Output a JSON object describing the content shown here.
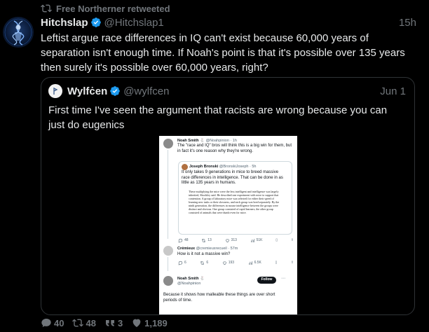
{
  "retweet": {
    "label": "Free Northerner retweeted",
    "icon": "retweet-icon"
  },
  "tweet": {
    "author": {
      "name": "Hitchslap",
      "handle": "@Hitchslap1",
      "verified": true
    },
    "time": "15h",
    "text": "Leftist argue race differences in IQ can't exist because 60,000 years of separation isn't enough time. If Noah's point is that it's possible over 135 years then surely it's possible over 60,000 years, right?"
  },
  "quote": {
    "author": {
      "name": "Wylfċen",
      "handle": "@wylfcen",
      "verified": true
    },
    "time": "Jun 1",
    "text": "First time I've seen the argument that racists are wrong because you can just do eugenics",
    "screenshot": {
      "post1": {
        "name": "Noah Smith",
        "emoji": "🐇",
        "handle": "@Noahpinion",
        "time": "· 1h",
        "text": "The \"race and IQ\" bros will think this is a big win for them, but in fact it's one reason why they're wrong.",
        "quoted": {
          "name": "Joseph Bronski",
          "handle": "@BronskiJoseph",
          "time": "· 5h",
          "text": "It only takes 9 generations in mice to breed massive race differences in intelligence. That can be done in as little as 135 years in humans.",
          "page_text": "These multiplying the mice were the less intelligent and intelligence was largely inherited, Shockley said. He described one experiment with mice to support that contention. A group of laboratory mice was selected for either their speed of learning new tasks or their slowness, and each group was bred separately. By the ninth generation, the differences in mouse intelligence between the groups were distinct and obvious. One group consisted of rapid learners, the other group consisted of animals that were dumb even for mice."
        },
        "stats": {
          "replies": "48",
          "retweets": "13",
          "likes": "313",
          "views": "51K"
        }
      },
      "post2": {
        "name": "Crémieux",
        "handle": "@cremieuxrecueil",
        "time": "· 57m",
        "text": "How is it not a massive win?",
        "stats": {
          "replies": "6",
          "retweets": "6",
          "likes": "193",
          "views": "6.5K"
        }
      },
      "post3": {
        "name": "Noah Smith",
        "emoji": "🐇",
        "handle": "@Noahpinion",
        "follow_label": "Follow",
        "text": "Because it shows how malleable these things are over short periods of time."
      }
    }
  },
  "actions": {
    "replies": "40",
    "retweets": "48",
    "quotes": "3",
    "likes": "1,189"
  },
  "colors": {
    "background": "#000000",
    "text": "#e7e9ea",
    "muted": "#71767b",
    "verified": "#1d9bf0",
    "border": "#2f3336"
  }
}
